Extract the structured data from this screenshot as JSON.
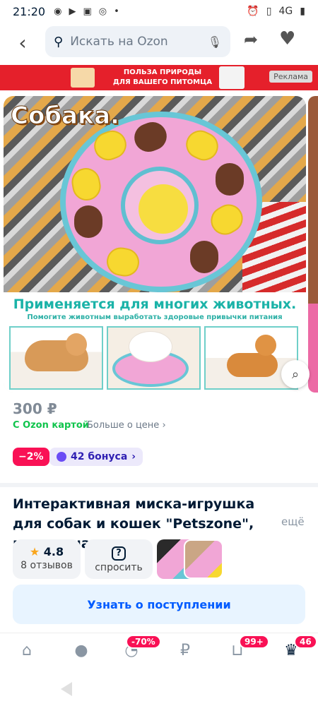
{
  "status_bar": {
    "time": "21:20",
    "left_icons": [
      "chat-icon",
      "youtube-icon",
      "mi-icon",
      "target-icon",
      "dot"
    ],
    "right_icons": [
      "alarm-icon",
      "vibrate-icon",
      "signal-4g-icon",
      "battery-icon"
    ],
    "signal_label": "4G"
  },
  "header": {
    "search_placeholder": "Искать на Ozon"
  },
  "ad_banner": {
    "line1": "ПОЛЬЗА ПРИРОДЫ",
    "line2": "ДЛЯ ВАШЕГО ПИТОМЦА",
    "tag": "Реклама"
  },
  "gallery": {
    "overlay_title": "Собака.",
    "headline": "Применяется для многих животных.",
    "subline": "Помогите животным выработать здоровые привычки питания"
  },
  "price": {
    "value": "300 ₽",
    "ozon_card_label": "С Ozon картой",
    "more_price_label": "Больше о цене",
    "discount_badge": "−2%",
    "bonus_label": "42 бонуса"
  },
  "product": {
    "title": "Интерактивная миска-игрушка для собак и кошек \"Petszone\", медленна",
    "more_label": "ещё",
    "rating": "4.8",
    "reviews": "8 отзывов",
    "ask_label": "спросить",
    "notify_button": "Узнать о поступлении"
  },
  "tabbar": {
    "badges": {
      "sale": "-70%",
      "cart": "99+",
      "profile": "46"
    }
  },
  "colors": {
    "brand_blue": "#005bff",
    "discount_pink": "#f91155",
    "ozon_green": "#10c44c",
    "bonus_purple": "#2f1fb3",
    "ad_red": "#e5202b"
  }
}
